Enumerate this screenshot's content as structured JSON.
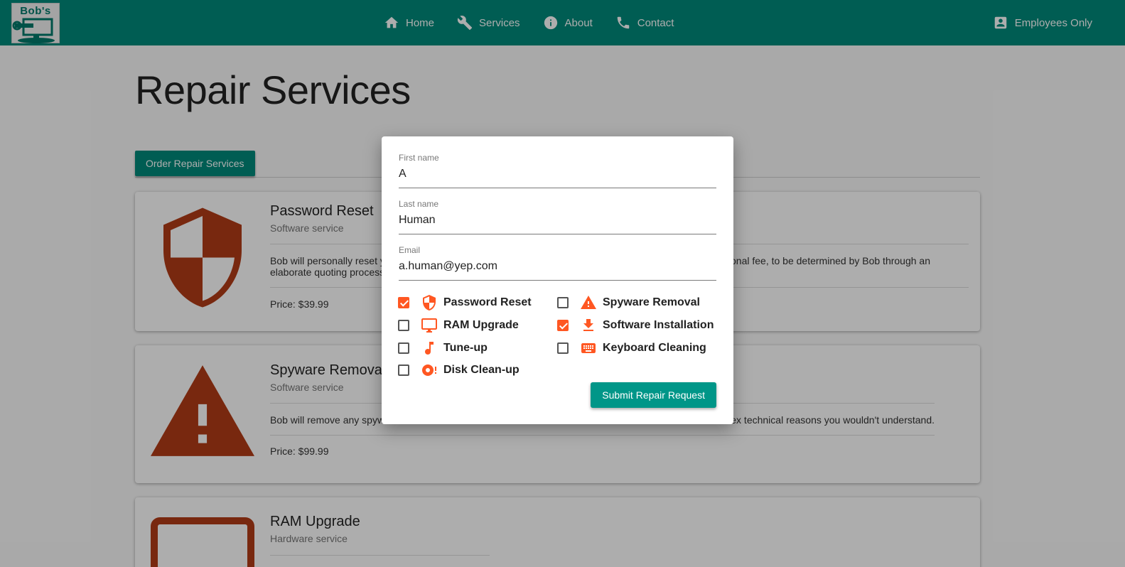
{
  "brand": {
    "logo_text": "Bob's"
  },
  "nav": {
    "items": [
      {
        "label": "Home",
        "icon": "home-icon"
      },
      {
        "label": "Services",
        "icon": "wrench-icon"
      },
      {
        "label": "About",
        "icon": "info-icon"
      },
      {
        "label": "Contact",
        "icon": "phone-icon"
      }
    ],
    "employees": {
      "label": "Employees Only",
      "icon": "account-box-icon"
    }
  },
  "page": {
    "title": "Repair Services",
    "order_button": "Order Repair Services"
  },
  "cards": [
    {
      "title": "Password Reset",
      "subtitle": "Software service",
      "description_left": "Bob will personally reset y",
      "description_left2": "elaborate quoting process",
      "description_right": "onal fee, to be determined by Bob through an",
      "price": "Price: $39.99",
      "icon": "shield-icon"
    },
    {
      "title": "Spyware Remova",
      "subtitle": "Software service",
      "description_left": "Bob will remove any spyw",
      "description_right": "ex technical reasons you wouldn't understand.",
      "price": "Price: $99.99",
      "icon": "warning-icon"
    },
    {
      "title": "RAM Upgrade",
      "subtitle": "Hardware service",
      "icon": "monitor-icon"
    }
  ],
  "dialog": {
    "fields": [
      {
        "label": "First name",
        "value": "A"
      },
      {
        "label": "Last name",
        "value": "Human"
      },
      {
        "label": "Email",
        "value": "a.human@yep.com"
      }
    ],
    "services": [
      {
        "label": "Password Reset",
        "checked": true,
        "icon": "shield-icon"
      },
      {
        "label": "Spyware Removal",
        "checked": false,
        "icon": "warning-icon"
      },
      {
        "label": "RAM Upgrade",
        "checked": false,
        "icon": "monitor-icon"
      },
      {
        "label": "Software Installation",
        "checked": true,
        "icon": "download-icon"
      },
      {
        "label": "Tune-up",
        "checked": false,
        "icon": "music-note-icon"
      },
      {
        "label": "Keyboard Cleaning",
        "checked": false,
        "icon": "keyboard-icon"
      },
      {
        "label": "Disk Clean-up",
        "checked": false,
        "icon": "disc-alert-icon"
      }
    ],
    "submit_label": "Submit Repair Request"
  },
  "colors": {
    "primary": "#00897b",
    "accent": "#ff5722",
    "card_icon": "#b23c17"
  }
}
